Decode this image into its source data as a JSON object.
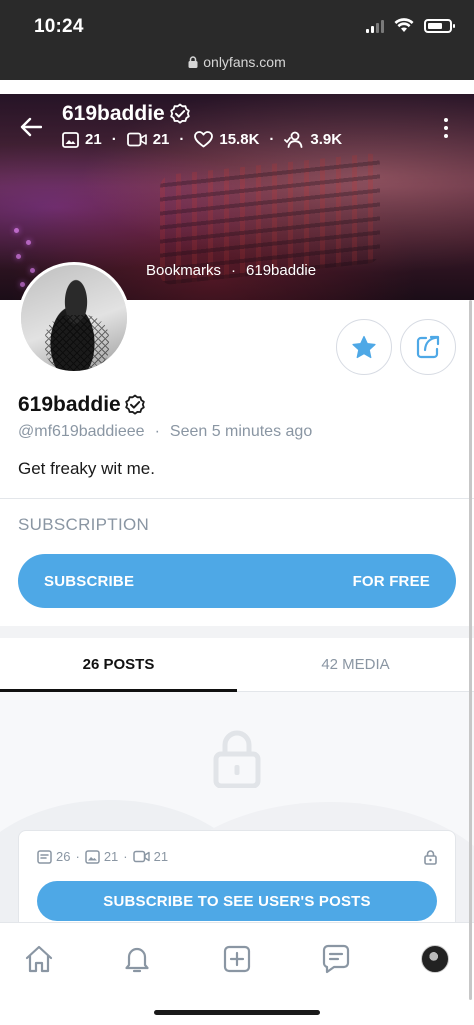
{
  "status_bar": {
    "time": "10:24"
  },
  "browser": {
    "url": "onlyfans.com"
  },
  "header": {
    "name": "619baddie",
    "stats": {
      "photos": "21",
      "videos": "21",
      "likes": "15.8K",
      "fans": "3.9K"
    },
    "breadcrumbs": [
      "Bookmarks",
      "619baddie"
    ]
  },
  "profile": {
    "name": "619baddie",
    "handle": "@mf619baddieee",
    "last_seen": "Seen 5 minutes ago",
    "bio": "Get freaky wit me."
  },
  "subscription": {
    "title": "SUBSCRIPTION",
    "button_label": "SUBSCRIBE",
    "button_price": "FOR FREE"
  },
  "tabs": [
    {
      "label": "26 POSTS",
      "active": true
    },
    {
      "label": "42 MEDIA",
      "active": false
    }
  ],
  "locked_card": {
    "posts": "26",
    "photos": "21",
    "videos": "21",
    "button_label": "SUBSCRIBE TO SEE USER'S POSTS"
  },
  "bottom_nav": [
    "home-icon",
    "bell-icon",
    "add-post-icon",
    "messages-icon",
    "profile-avatar"
  ],
  "colors": {
    "accent": "#4ea8e6",
    "muted": "#8a96a3",
    "status_bar": "#2a2a2a"
  }
}
